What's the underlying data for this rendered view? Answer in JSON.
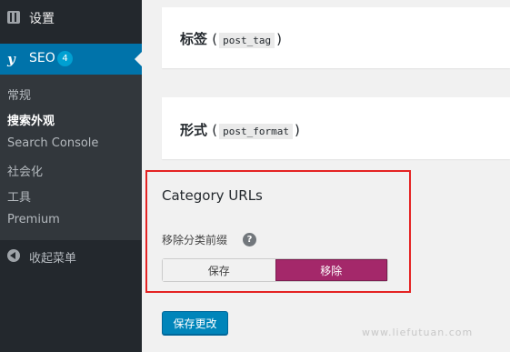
{
  "sidebar": {
    "settings_label": "设置",
    "seo_label": "SEO",
    "seo_badge": "4",
    "sub_items": [
      {
        "label": "常规",
        "active": false
      },
      {
        "label": "搜索外观",
        "active": true
      },
      {
        "label": "Search Console",
        "active": false
      },
      {
        "label": "社会化",
        "active": false
      },
      {
        "label": "工具",
        "active": false
      },
      {
        "label": "Premium",
        "active": false
      }
    ],
    "collapse_label": "收起菜单"
  },
  "main": {
    "tag_section": {
      "title": "标签",
      "code": "post_tag"
    },
    "format_section": {
      "title": "形式",
      "code": "post_format"
    },
    "category_urls": {
      "title": "Category URLs",
      "remove_prefix_label": "移除分类前缀",
      "help_symbol": "?",
      "toggle": {
        "keep_label": "保存",
        "remove_label": "移除",
        "selected": "remove"
      }
    },
    "save_button": "保存更改"
  },
  "watermark": "www.liefutuan.com",
  "colors": {
    "sidebar_bg": "#23282d",
    "active_blue": "#0073aa",
    "toggle_active": "#a4286a",
    "highlight_red": "#e42323",
    "button_blue": "#0085ba"
  }
}
